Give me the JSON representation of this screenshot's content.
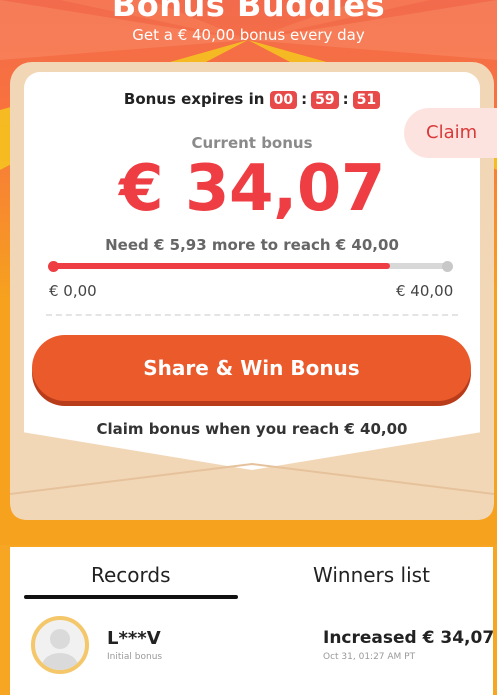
{
  "header": {
    "title": "Bonus Buddies",
    "subtitle": "Get a € 40,00 bonus every day"
  },
  "timer": {
    "label": "Bonus expires in",
    "hours": "00",
    "minutes": "59",
    "seconds": "51"
  },
  "claim_label": "Claim",
  "bonus": {
    "current_label": "Current bonus",
    "amount": "€ 34,07",
    "need_text": "Need € 5,93 more to reach € 40,00",
    "progress_fraction": 0.852,
    "min_label": "€ 0,00",
    "max_label": "€ 40,00"
  },
  "share_button": "Share & Win Bonus",
  "hint": "Claim bonus when you reach € 40,00",
  "tabs": [
    "Records",
    "Winners list"
  ],
  "record": {
    "name": "L***V",
    "note": "Initial bonus",
    "increase": "Increased € 34,07",
    "time": "Oct 31, 01:27 AM PT"
  },
  "colors": {
    "accent_red": "#ee3e43",
    "button_orange": "#ea5a2b",
    "background_orange": "#f6a21e"
  }
}
